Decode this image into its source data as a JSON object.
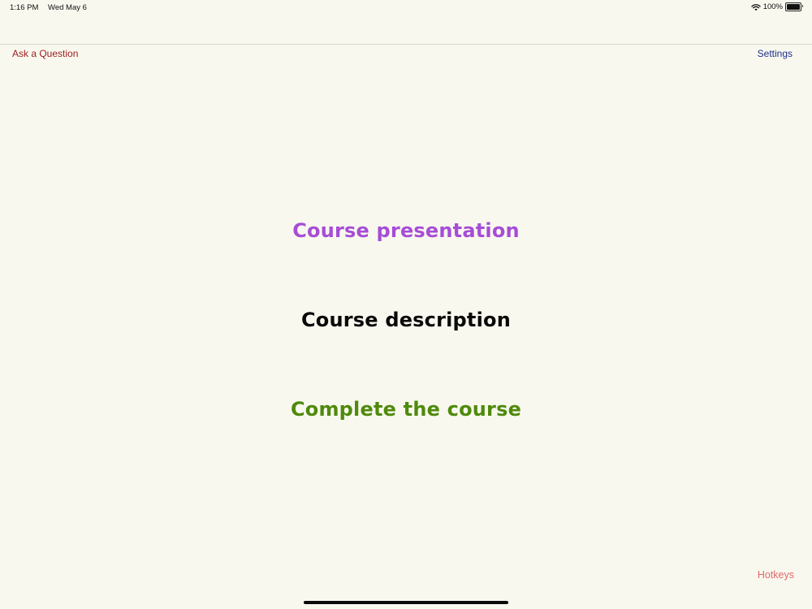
{
  "status_bar": {
    "time": "1:16 PM",
    "date": "Wed May 6",
    "battery_percent": "100%",
    "battery_level": 1.0,
    "wifi_icon": "wifi-icon",
    "battery_icon": "battery-icon"
  },
  "nav": {
    "left_button": "Ask a Question",
    "right_button": "Settings"
  },
  "menu": {
    "items": [
      {
        "label": "Course presentation",
        "color": "#a64dd6"
      },
      {
        "label": "Course description",
        "color": "#0a0a0a"
      },
      {
        "label": "Complete the course",
        "color": "#4f8a0b"
      }
    ]
  },
  "footer": {
    "hotkeys": "Hotkeys"
  },
  "colors": {
    "background": "#f9f8ef",
    "ask_question": "#9b1c1c",
    "settings": "#1f2f8f",
    "hotkeys": "#e06a6a"
  }
}
